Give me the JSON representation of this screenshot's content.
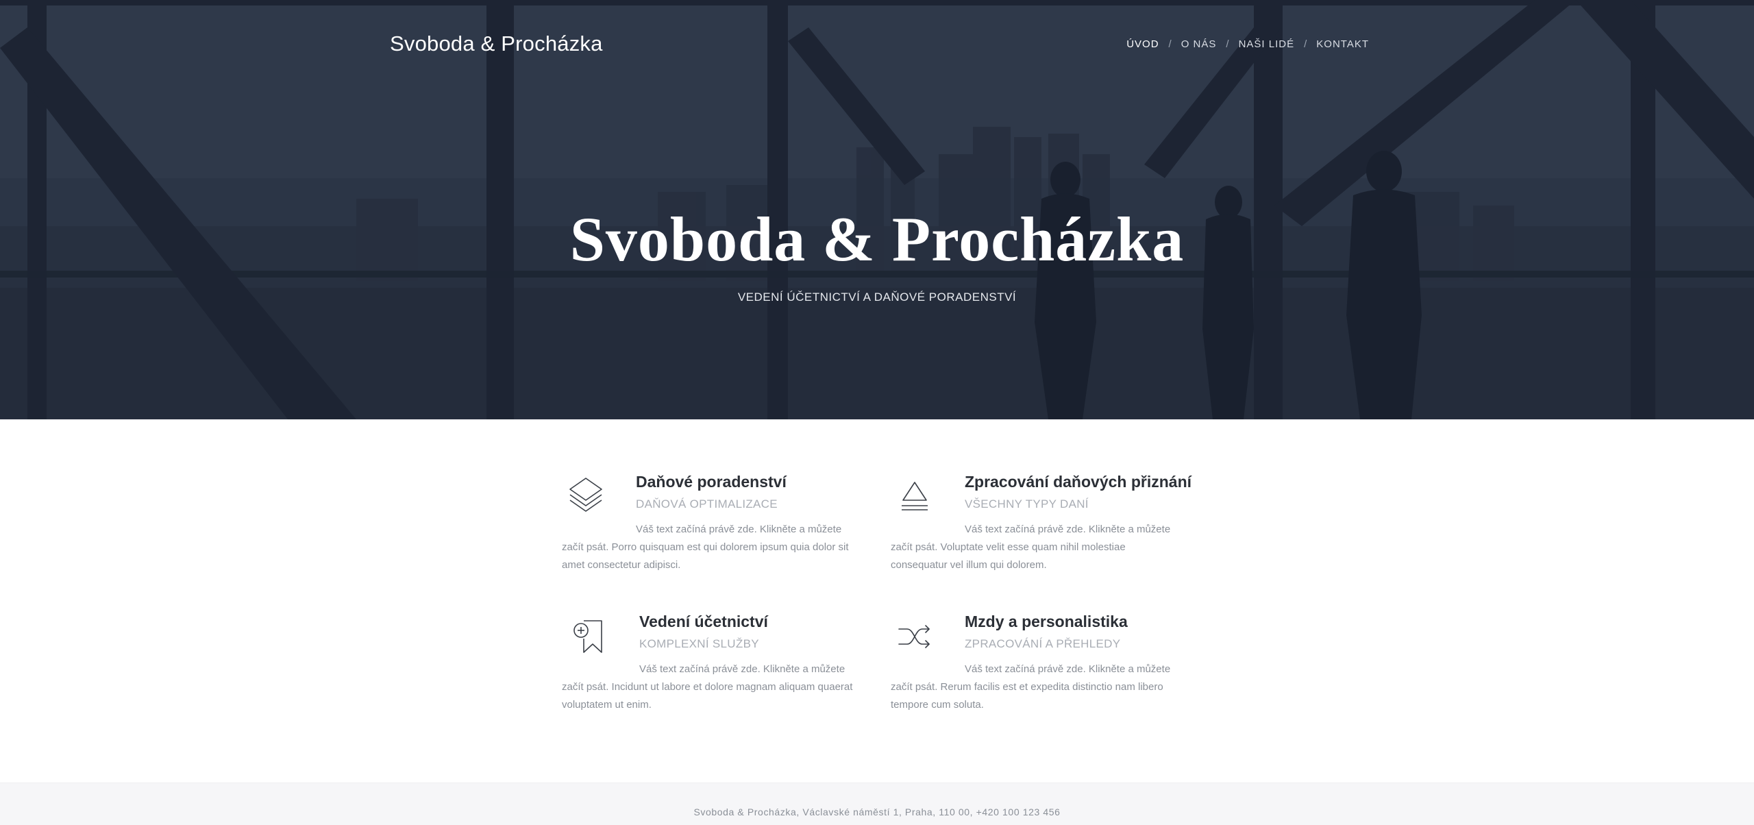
{
  "header": {
    "brand": "Svoboda & Procházka",
    "nav": [
      {
        "label": "ÚVOD",
        "active": true
      },
      {
        "label": "O NÁS",
        "active": false
      },
      {
        "label": "NAŠI LIDÉ",
        "active": false
      },
      {
        "label": "KONTAKT",
        "active": false
      }
    ],
    "separator": "/"
  },
  "hero": {
    "title": "Svoboda & Procházka",
    "subtitle": "VEDENÍ ÚČETNICTVÍ A DAŇOVÉ PORADENSTVÍ"
  },
  "services": [
    {
      "icon": "layers-icon",
      "title": "Daňové poradenství",
      "subtitle": "DAŇOVÁ OPTIMALIZACE",
      "text_lines": [
        "Váš text začíná právě zde. Klikněte a můžete",
        "začít psát. Porro quisquam est qui dolorem ipsum quia dolor sit",
        "amet consectetur adipisci."
      ]
    },
    {
      "icon": "eject-icon",
      "title": "Zpracování daňových přiznání",
      "subtitle": "VŠECHNY TYPY DANÍ",
      "text_lines": [
        "Váš text začíná právě zde. Klikněte a můžete",
        "začít psát. Voluptate velit esse quam nihil molestiae",
        "consequatur vel illum qui dolorem."
      ]
    },
    {
      "icon": "bookmark-plus-icon",
      "title": "Vedení účetnictví",
      "subtitle": "KOMPLEXNÍ SLUŽBY",
      "text_lines": [
        "Váš text začíná právě zde. Klikněte a můžete",
        "začít psát. Incidunt ut labore et dolore magnam aliquam quaerat",
        "voluptatem ut enim."
      ]
    },
    {
      "icon": "shuffle-icon",
      "title": "Mzdy a personalistika",
      "subtitle": "ZPRACOVÁNÍ A PŘEHLEDY",
      "text_lines": [
        "Váš text začíná právě zde. Klikněte a můžete",
        "začít psát. Rerum facilis est et expedita distinctio nam libero",
        "tempore cum soluta."
      ]
    }
  ],
  "footer": {
    "text": "Svoboda & Procházka, Václavské náměstí 1, Praha, 110 00, +420 100 123 456"
  },
  "colors": {
    "hero_overlay": "#2c3545",
    "text_dark": "#2b2f36",
    "text_muted": "#8a8f97",
    "subtitle_gray": "#a9adb4",
    "footer_bg": "#f6f6f8"
  }
}
